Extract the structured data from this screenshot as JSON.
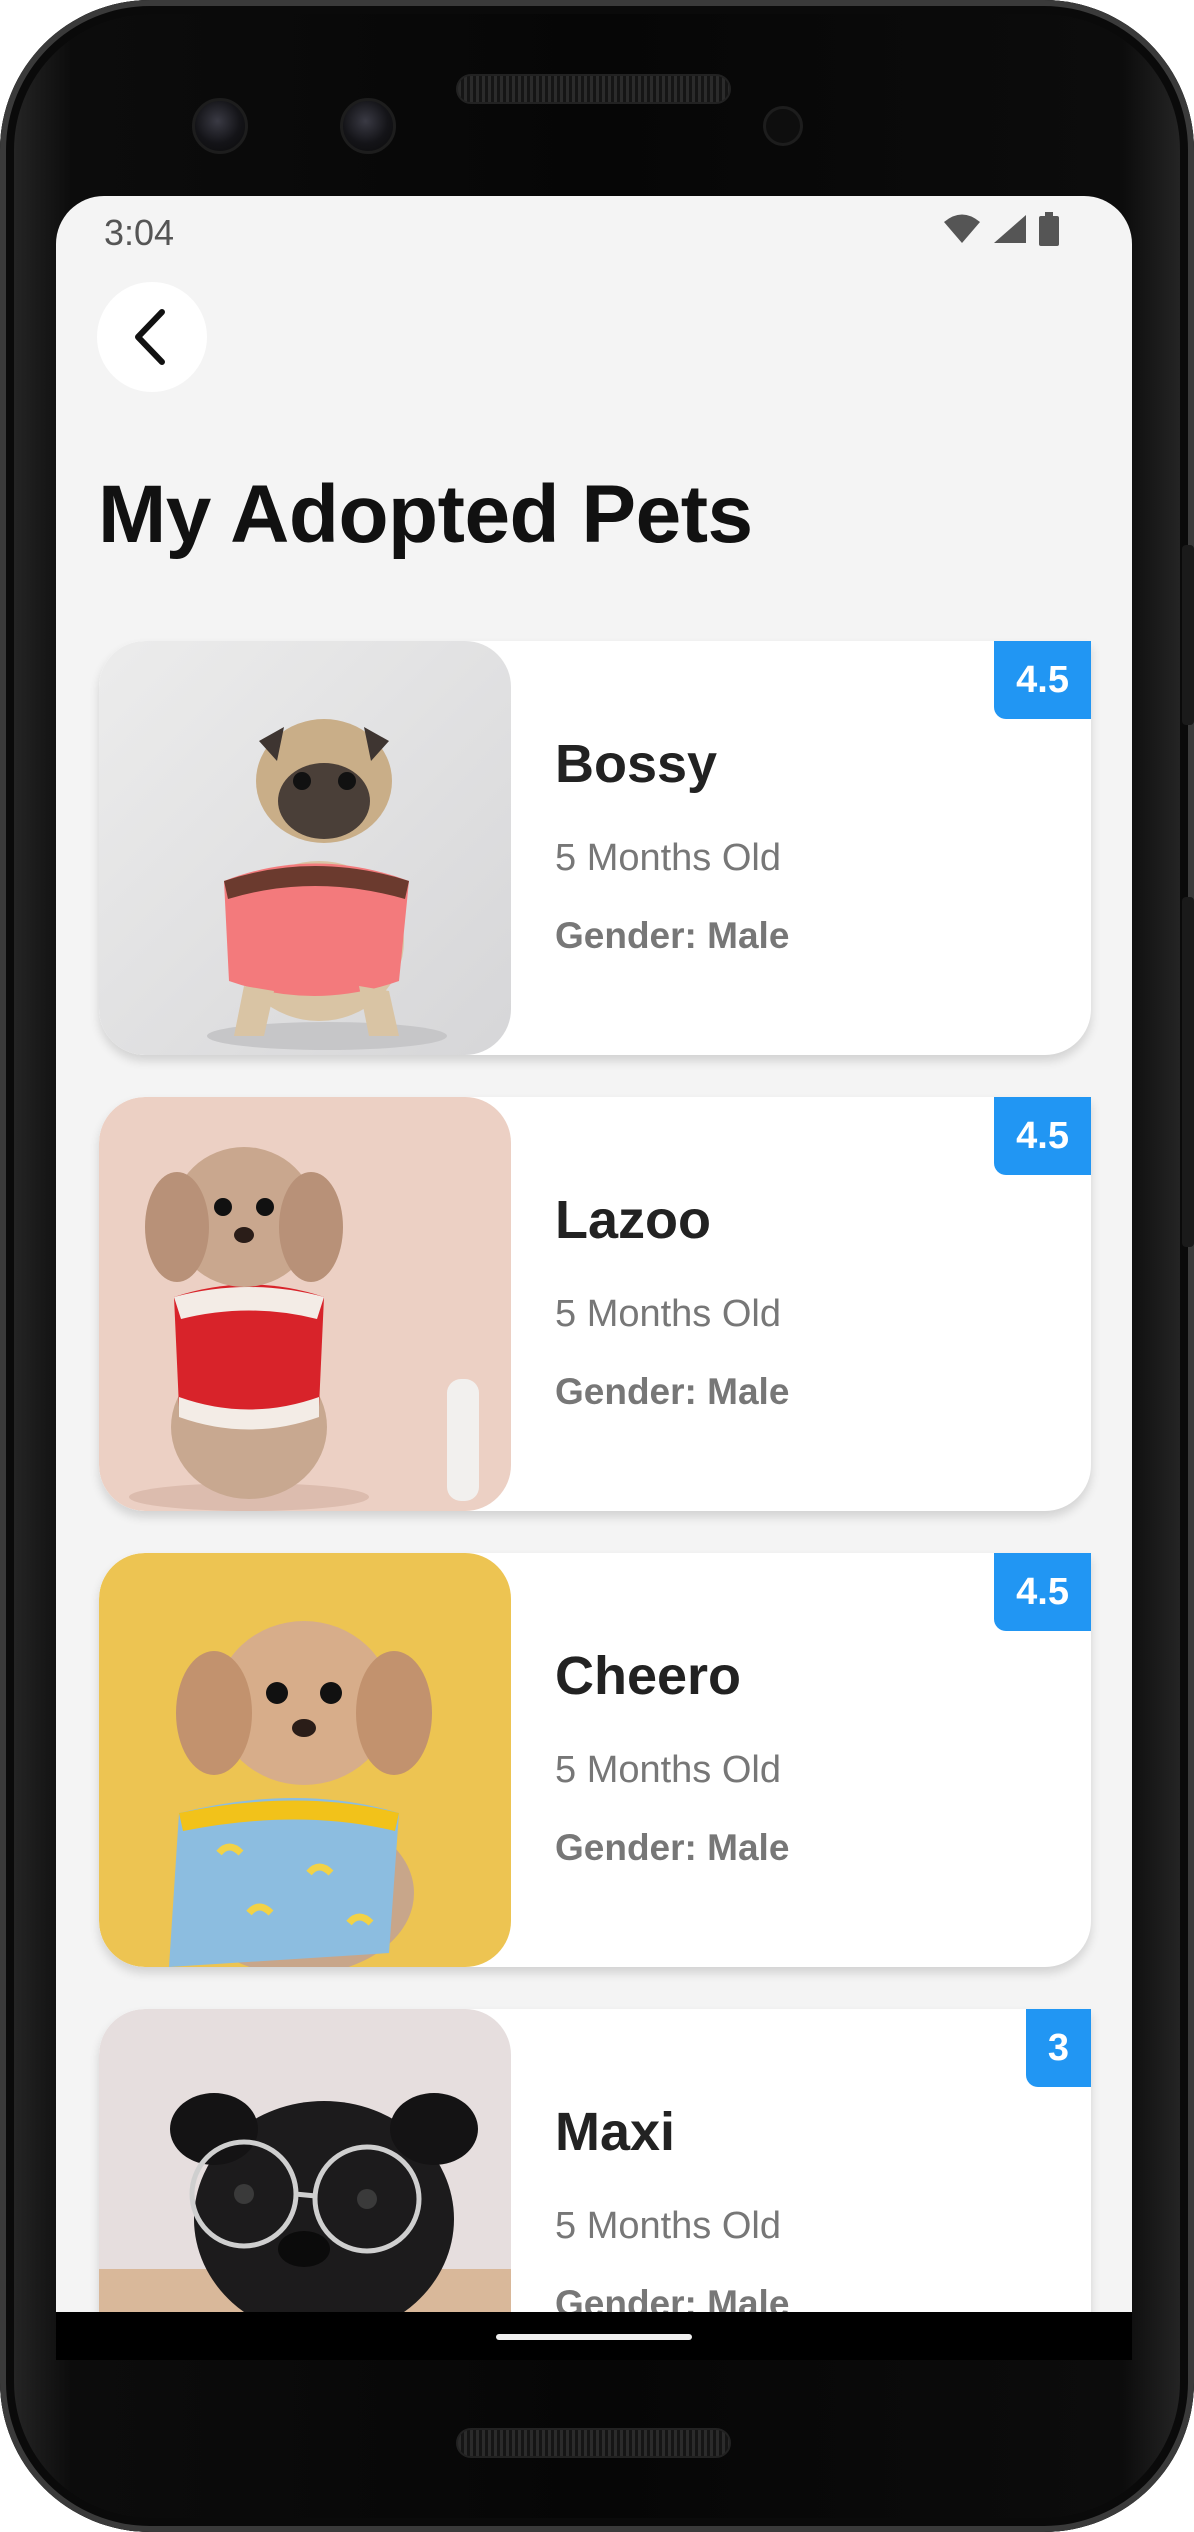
{
  "status_bar": {
    "time": "3:04",
    "icons": [
      "wifi-icon",
      "signal-icon",
      "battery-icon"
    ]
  },
  "header": {
    "back_icon": "chevron-left-icon",
    "title": "My Adopted Pets"
  },
  "pets": [
    {
      "name": "Bossy",
      "age": "5 Months Old",
      "gender": "Gender: Male",
      "rating": "4.5",
      "photo": "pug in pink shirt on grey background"
    },
    {
      "name": "Lazoo",
      "age": "5 Months Old",
      "gender": "Gender: Male",
      "rating": "4.5",
      "photo": "small dog in red santa coat on peach background"
    },
    {
      "name": "Cheero",
      "age": "5 Months Old",
      "gender": "Gender: Male",
      "rating": "4.5",
      "photo": "small dog in blue banana print shirt on yellow background"
    },
    {
      "name": "Maxi",
      "age": "5 Months Old",
      "gender": "Gender: Male",
      "rating": "3",
      "photo": "black pug wearing round glasses"
    }
  ],
  "colors": {
    "accent": "#2196f3",
    "background": "#f4f4f4",
    "card": "#ffffff",
    "title": "#111111",
    "muted": "#777777"
  }
}
